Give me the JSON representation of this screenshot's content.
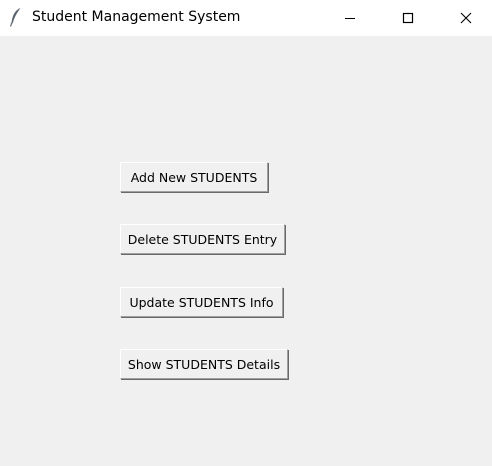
{
  "window": {
    "title": "Student Management System",
    "icon": "feather-icon",
    "controls": {
      "minimize": "minimize-icon",
      "maximize": "maximize-icon",
      "close": "close-icon"
    }
  },
  "buttons": {
    "add": "Add New STUDENTS",
    "delete": "Delete STUDENTS Entry",
    "update": "Update STUDENTS Info",
    "show": "Show STUDENTS Details"
  },
  "colors": {
    "background": "#f0f0f0",
    "titlebar": "#ffffff"
  }
}
